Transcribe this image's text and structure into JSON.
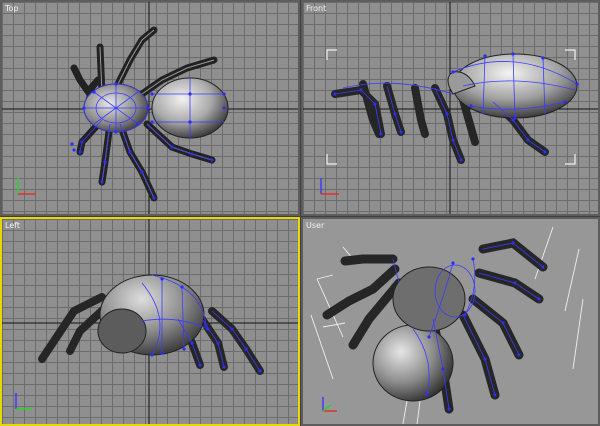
{
  "viewports": [
    {
      "id": "top",
      "label": "Top",
      "active": false
    },
    {
      "id": "front",
      "label": "Front",
      "active": false
    },
    {
      "id": "left",
      "label": "Left",
      "active": true
    },
    {
      "id": "user",
      "label": "User",
      "active": false
    }
  ],
  "colors": {
    "grid_bg": "#8f8f8f",
    "grid_line": "#6c6c6c",
    "axis_line": "#111111",
    "active_border": "#e7d800",
    "wire": "#3b3bff",
    "vertex": "#2d2dff",
    "mesh_dark": "#3a3a3a",
    "mesh_light": "#e0e0e0"
  },
  "icons": [
    "axis-tripod-icon"
  ]
}
